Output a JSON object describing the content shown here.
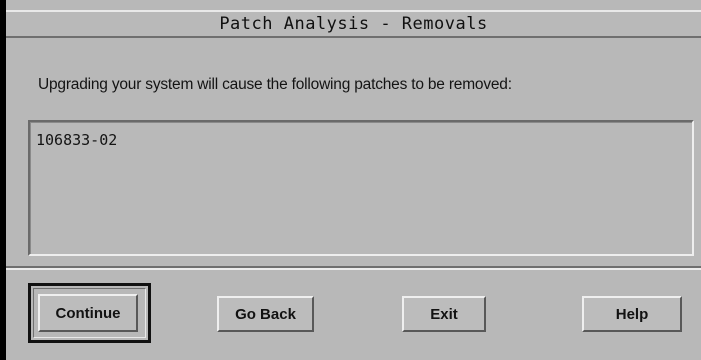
{
  "window": {
    "title": "Patch Analysis - Removals"
  },
  "main": {
    "message": "Upgrading your system will cause the following patches to be removed:",
    "patches": [
      "106833-02"
    ]
  },
  "buttons": {
    "continue": "Continue",
    "go_back": "Go Back",
    "exit": "Exit",
    "help": "Help"
  }
}
